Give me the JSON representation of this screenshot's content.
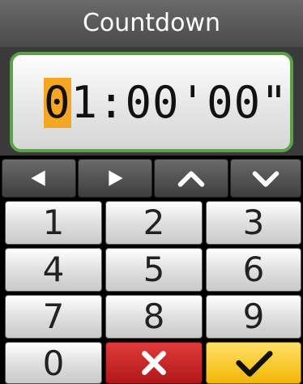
{
  "title": "Countdown",
  "display": {
    "cursor_digit": "0",
    "rest": "1:00'00\""
  },
  "nav_keys": [
    {
      "icon": "left-arrow-icon"
    },
    {
      "icon": "right-arrow-icon"
    },
    {
      "icon": "up-chevron-icon"
    },
    {
      "icon": "down-chevron-icon"
    }
  ],
  "keypad": {
    "k1": "1",
    "k2": "2",
    "k3": "3",
    "k4": "4",
    "k5": "5",
    "k6": "6",
    "k7": "7",
    "k8": "8",
    "k9": "9",
    "k0": "0"
  },
  "action_icons": {
    "cancel": "close-icon",
    "ok": "checkmark-icon"
  },
  "colors": {
    "highlight": "#f5a623",
    "display_border": "#5aa24a",
    "cancel": "#c62828",
    "ok": "#f5c518"
  }
}
